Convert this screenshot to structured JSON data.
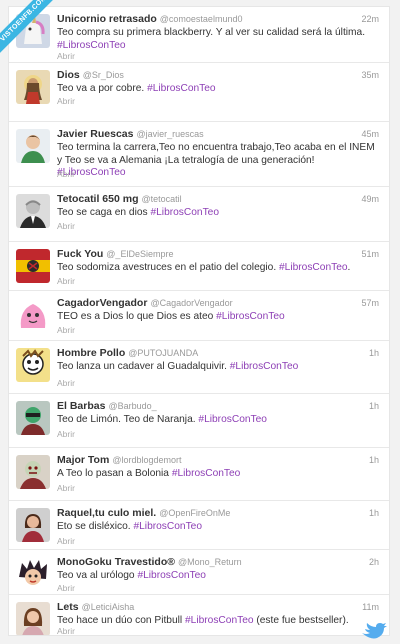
{
  "watermark": "VISTOENFB.COM",
  "colors": {
    "hashtag": "#8d3fb5",
    "ribbon": "#3bb6e3",
    "bird": "#55acee"
  },
  "action_label": "Abrir",
  "tweets": [
    {
      "name": "Unicornio retrasado",
      "handle": "@comoestaelmund0",
      "time": "22m",
      "text_before": "Teo compra su primera blackberry. Y al ver su calidad será la última.",
      "hashtag": "#LibrosConTeo",
      "text_after": "",
      "avatar": "unicorn-avatar"
    },
    {
      "name": "Dios",
      "handle": "@Sr_Dios",
      "time": "35m",
      "text_before": "Teo va a por cobre.",
      "hashtag": "#LibrosConTeo",
      "text_after": "",
      "avatar": "jesus-avatar"
    },
    {
      "name": "Javier Ruescas",
      "handle": "@javier_ruescas",
      "time": "45m",
      "text_before": "Teo termina la carrera,Teo no encuentra trabajo,Teo acaba en el INEM y Teo se va a Alemania ¡La tetralogía de una generación!",
      "hashtag": "#LibrosConTeo",
      "text_after": "",
      "avatar": "person-avatar"
    },
    {
      "name": "Tetocatil 650 mg",
      "handle": "@tetocatil",
      "time": "49m",
      "text_before": "Teo se caga en dios",
      "hashtag": "#LibrosConTeo",
      "text_after": "",
      "avatar": "old-man-avatar"
    },
    {
      "name": "Fuck You",
      "handle": "@_ElDeSiempre",
      "time": "51m",
      "text_before": "Teo sodomiza avestruces en el patio del colegio.",
      "hashtag": "#LibrosConTeo",
      "text_after": ".",
      "avatar": "flag-avatar"
    },
    {
      "name": "CagadorVengador",
      "handle": "@CagadorVengador",
      "time": "57m",
      "text_before": "TEO es a Dios lo que Dios es ateo",
      "hashtag": "#LibrosConTeo",
      "text_after": "",
      "avatar": "pink-blob-avatar"
    },
    {
      "name": "Hombre Pollo",
      "handle": "@PUTOJUANDA",
      "time": "1h",
      "text_before": "Teo lanza un cadaver al Guadalquivir.",
      "hashtag": "#LibrosConTeo",
      "text_after": "",
      "avatar": "cartoon-avatar"
    },
    {
      "name": "El Barbas",
      "handle": "@Barbudo_",
      "time": "1h",
      "text_before": "Teo de Limón. Teo de Naranja.",
      "hashtag": "#LibrosConTeo",
      "text_after": "",
      "avatar": "masked-avatar"
    },
    {
      "name": "Major Tom",
      "handle": "@lordblogdemort",
      "time": "1h",
      "text_before": "A Teo lo pasan a Bolonia",
      "hashtag": "#LibrosConTeo",
      "text_after": "",
      "avatar": "zombie-avatar"
    },
    {
      "name": "Raquel,tu culo miel.",
      "handle": "@OpenFireOnMe",
      "time": "1h",
      "text_before": "Eto se disléxico.",
      "hashtag": "#LibrosConTeo",
      "text_after": "",
      "avatar": "girl-avatar"
    },
    {
      "name": "MonoGoku Travestido®",
      "handle": "@Mono_Return",
      "time": "2h",
      "text_before": "Teo va al urólogo",
      "hashtag": "#LibrosConTeo",
      "text_after": "",
      "avatar": "anime-avatar"
    },
    {
      "name": "Lets",
      "handle": "@LeticiAisha",
      "time": "11m",
      "text_before": "Teo hace un dúo con Pitbull",
      "hashtag": "#LibrosConTeo",
      "text_after": " (este fue bestseller).",
      "avatar": "woman-avatar"
    }
  ]
}
